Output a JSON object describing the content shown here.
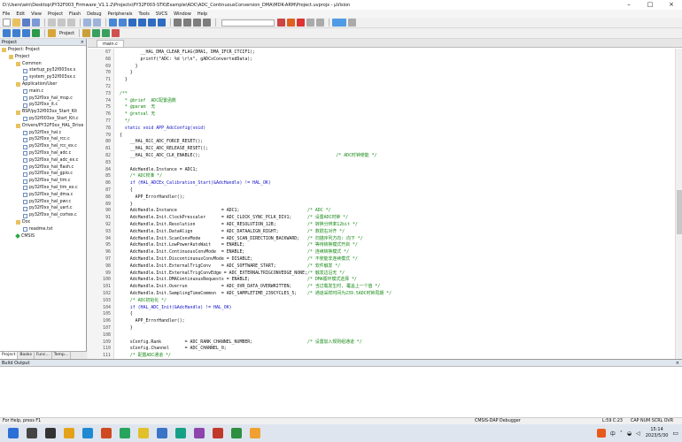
{
  "window": {
    "title": "D:\\Users\\win\\Desktop\\PY32F003_Firmware_V1.1.2\\Projects\\PY32F003-STK\\Example\\ADC\\ADC_ContinuousConversion_DMA\\MDK-ARM\\Project.uvprojx - µVision"
  },
  "menu": [
    "File",
    "Edit",
    "View",
    "Project",
    "Flash",
    "Debug",
    "Peripherals",
    "Tools",
    "SVCS",
    "Window",
    "Help"
  ],
  "toolbar2": {
    "target_label": "Project"
  },
  "project_pane": {
    "header": "Project",
    "tree": [
      {
        "label": "Project: Project",
        "level": 0,
        "icon": "root"
      },
      {
        "label": "Project",
        "level": 1,
        "icon": "folder"
      },
      {
        "label": "Common",
        "level": 2,
        "icon": "folder"
      },
      {
        "label": "startup_py32f003xx.s",
        "level": 3,
        "icon": "file"
      },
      {
        "label": "system_py32f003xx.c",
        "level": 3,
        "icon": "file"
      },
      {
        "label": "Application/User",
        "level": 2,
        "icon": "folder"
      },
      {
        "label": "main.c",
        "level": 3,
        "icon": "file"
      },
      {
        "label": "py32f0xx_hal_msp.c",
        "level": 3,
        "icon": "file"
      },
      {
        "label": "py32f0xx_it.c",
        "level": 3,
        "icon": "file"
      },
      {
        "label": "BSP/py32f003xx_Start_Kit",
        "level": 2,
        "icon": "folder"
      },
      {
        "label": "py32f003xx_Start_Kit.c",
        "level": 3,
        "icon": "file"
      },
      {
        "label": "Drivers/PY32F0xx_HAL_Drive",
        "level": 2,
        "icon": "folder"
      },
      {
        "label": "py32f0xx_hal.c",
        "level": 3,
        "icon": "file"
      },
      {
        "label": "py32f0xx_hal_rcc.c",
        "level": 3,
        "icon": "file"
      },
      {
        "label": "py32f0xx_hal_rcc_ex.c",
        "level": 3,
        "icon": "file"
      },
      {
        "label": "py32f0xx_hal_adc.c",
        "level": 3,
        "icon": "file"
      },
      {
        "label": "py32f0xx_hal_adc_ex.c",
        "level": 3,
        "icon": "file"
      },
      {
        "label": "py32f0xx_hal_flash.c",
        "level": 3,
        "icon": "file"
      },
      {
        "label": "py32f0xx_hal_gpio.c",
        "level": 3,
        "icon": "file"
      },
      {
        "label": "py32f0xx_hal_tim.c",
        "level": 3,
        "icon": "file"
      },
      {
        "label": "py32f0xx_hal_tim_ex.c",
        "level": 3,
        "icon": "file"
      },
      {
        "label": "py32f0xx_hal_dma.c",
        "level": 3,
        "icon": "file"
      },
      {
        "label": "py32f0xx_hal_pwr.c",
        "level": 3,
        "icon": "file"
      },
      {
        "label": "py32f0xx_hal_uart.c",
        "level": 3,
        "icon": "file"
      },
      {
        "label": "py32f0xx_hal_cortex.c",
        "level": 3,
        "icon": "file"
      },
      {
        "label": "Doc",
        "level": 2,
        "icon": "folder"
      },
      {
        "label": "readme.txt",
        "level": 3,
        "icon": "file"
      },
      {
        "label": "CMSIS",
        "level": 2,
        "icon": "gem"
      }
    ],
    "tabs": [
      "Project",
      "Books",
      "Func...",
      "Temp..."
    ]
  },
  "editor": {
    "tab": "main.c",
    "lines": [
      {
        "n": "67",
        "code": "        __HAL_DMA_CLEAR_FLAG(DMA1, DMA_IFCR_CTCIF1);",
        "c": ""
      },
      {
        "n": "68",
        "code": "        printf(\"ADC: %d \\r\\n\", gADCxConvertedData);",
        "c": ""
      },
      {
        "n": "69",
        "code": "      }",
        "c": ""
      },
      {
        "n": "70",
        "code": "    }",
        "c": ""
      },
      {
        "n": "71",
        "code": "  }",
        "c": ""
      },
      {
        "n": "72",
        "code": "",
        "c": ""
      },
      {
        "n": "73",
        "code": "",
        "c": "/**"
      },
      {
        "n": "74",
        "code": "",
        "c": "  * @brief  ADC配置函数"
      },
      {
        "n": "75",
        "code": "",
        "c": "  * @param  无"
      },
      {
        "n": "76",
        "code": "",
        "c": "  * @retval 无"
      },
      {
        "n": "77",
        "code": "",
        "c": "  */"
      },
      {
        "n": "78",
        "code": "  static void APP_AdcConfig(void)",
        "c": ""
      },
      {
        "n": "79",
        "code": "{",
        "c": ""
      },
      {
        "n": "80",
        "code": "    __HAL_RCC_ADC_FORCE_RESET();",
        "c": ""
      },
      {
        "n": "81",
        "code": "    __HAL_RCC_ADC_RELEASE_RESET();",
        "c": ""
      },
      {
        "n": "82",
        "code": "    __HAL_RCC_ADC_CLK_ENABLE();                                                    ",
        "c": "/* ADC时钟使能 */"
      },
      {
        "n": "83",
        "code": "",
        "c": ""
      },
      {
        "n": "84",
        "code": "    AdcHandle.Instance = ADC1;",
        "c": ""
      },
      {
        "n": "85",
        "code": "    ",
        "c": "/* ADC校准 */"
      },
      {
        "n": "86",
        "code": "    if (HAL_ADCEx_Calibration_Start(&AdcHandle) != HAL_OK)",
        "c": ""
      },
      {
        "n": "87",
        "code": "    {",
        "c": ""
      },
      {
        "n": "88",
        "code": "      APP_ErrorHandler();",
        "c": ""
      },
      {
        "n": "89",
        "code": "    }",
        "c": ""
      },
      {
        "n": "90",
        "code": "    AdcHandle.Instance                 = ADC1;                          ",
        "c": "/* ADC */"
      },
      {
        "n": "91",
        "code": "    AdcHandle.Init.ClockPrescaler      = ADC_CLOCK_SYNC_PCLK_DIV1;      ",
        "c": "/* 设置ADC时钟 */"
      },
      {
        "n": "92",
        "code": "    AdcHandle.Init.Resolution          = ADC_RESOLUTION_12B;            ",
        "c": "/* 转换分辨率12bit */"
      },
      {
        "n": "93",
        "code": "    AdcHandle.Init.DataAlign           = ADC_DATAALIGN_RIGHT;           ",
        "c": "/* 数据右对齐 */"
      },
      {
        "n": "94",
        "code": "    AdcHandle.Init.ScanConvMode        = ADC_SCAN_DIRECTION_BACKWARD;   ",
        "c": "/* 扫描序列方向: 向下 */"
      },
      {
        "n": "95",
        "code": "    AdcHandle.Init.LowPowerAutoWait    = ENABLE;                        ",
        "c": "/* 等待转换模式开启 */"
      },
      {
        "n": "96",
        "code": "    AdcHandle.Init.ContinuousConvMode  = ENABLE;                        ",
        "c": "/* 连续转换模式 */"
      },
      {
        "n": "97",
        "code": "    AdcHandle.Init.DiscontinuousConvMode = DISABLE;                     ",
        "c": "/* 不使能非连续模式 */"
      },
      {
        "n": "98",
        "code": "    AdcHandle.Init.ExternalTrigConv    = ADC_SOFTWARE_START;            ",
        "c": "/* 软件触发 */"
      },
      {
        "n": "99",
        "code": "    AdcHandle.Init.ExternalTrigConvEdge = ADC_EXTERNALTRIGCONVEDGE_NONE;",
        "c": "/* 触发边沿无 */"
      },
      {
        "n": "100",
        "code": "    AdcHandle.Init.DMAContinuousRequests = ENABLE;                      ",
        "c": "/* DMA循环模式选择 */"
      },
      {
        "n": "101",
        "code": "    AdcHandle.Init.Overrun             = ADC_OVR_DATA_OVERWRITTEN;      ",
        "c": "/* 当过载发生时, 覆盖上一个值 */"
      },
      {
        "n": "102",
        "code": "    AdcHandle.Init.SamplingTimeCommon  = ADC_SAMPLETIME_239CYCLES_5;    ",
        "c": "/* 通道采样时间为239.5ADC时钟周期 */"
      },
      {
        "n": "103",
        "code": "    ",
        "c": "/* ADC初始化 */"
      },
      {
        "n": "104",
        "code": "    if (HAL_ADC_Init(&AdcHandle) != HAL_OK)",
        "c": ""
      },
      {
        "n": "105",
        "code": "    {",
        "c": ""
      },
      {
        "n": "106",
        "code": "      APP_ErrorHandler();",
        "c": ""
      },
      {
        "n": "107",
        "code": "    }",
        "c": ""
      },
      {
        "n": "108",
        "code": "",
        "c": ""
      },
      {
        "n": "109",
        "code": "    sConfig.Rank         = ADC_RANK_CHANNEL_NUMBER;                     ",
        "c": "/* 设置加入规则组通道 */"
      },
      {
        "n": "110",
        "code": "    sConfig.Channel      = ADC_CHANNEL_0;",
        "c": ""
      },
      {
        "n": "111",
        "code": "    ",
        "c": "/* 配置ADC通道 */"
      }
    ]
  },
  "build_output": {
    "header": "Build Output"
  },
  "statusbar": {
    "help": "For Help, press F1",
    "debugger": "CMSIS-DAP Debugger",
    "position": "L:59 C:23",
    "caps": "CAP NUM SCRL OVR R/W"
  },
  "taskbar": {
    "time": "15:14",
    "date": "2023/5/30",
    "ime": "中"
  }
}
